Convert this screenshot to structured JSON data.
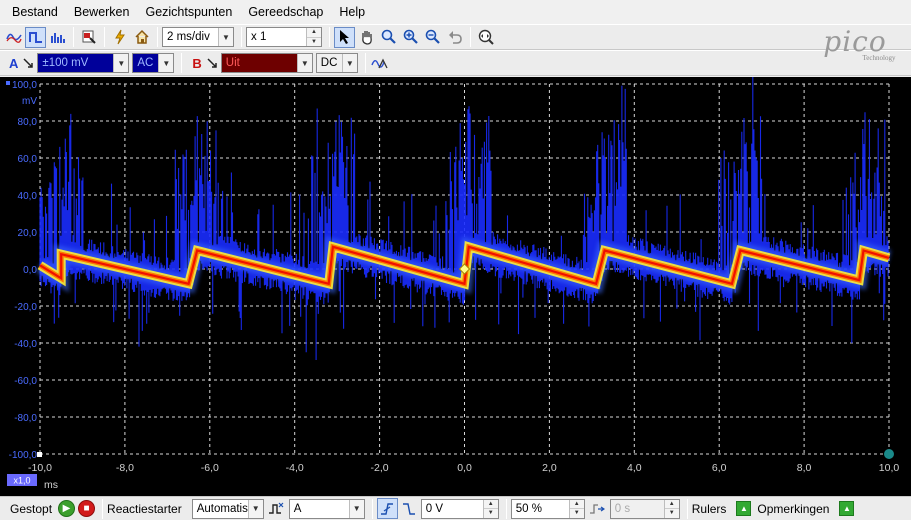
{
  "menu": [
    "Bestand",
    "Bewerken",
    "Gezichtspunten",
    "Gereedschap",
    "Help"
  ],
  "toolbar": {
    "timebase": "2 ms/div",
    "zoom_factor": "x 1",
    "icons": [
      "scope-mode-icon",
      "persistence-mode-icon",
      "spectrum-mode-icon",
      "record-icon",
      "signal-generator-icon",
      "home-icon",
      "select-tool-icon",
      "hand-tool-icon",
      "zoom-icon",
      "zoom-in-icon",
      "zoom-out-icon",
      "undo-zoom-icon",
      "zoom-fit-icon"
    ]
  },
  "channels": {
    "a": {
      "letter": "A",
      "range": "±100 mV",
      "coupling": "AC",
      "color": "#1d3ecf"
    },
    "b": {
      "letter": "B",
      "range": "Uit",
      "coupling": "DC",
      "color": "#c81010"
    }
  },
  "logo": {
    "word": "pico",
    "sub": "Technology"
  },
  "scope": {
    "y_unit": "mV",
    "y_ticks": [
      "100,0",
      "80,0",
      "60,0",
      "40,0",
      "20,0",
      "0,0",
      "-20,0",
      "-40,0",
      "-60,0",
      "-80,0",
      "-100,0"
    ],
    "x_ticks": [
      "-10,0",
      "-8,0",
      "-6,0",
      "-4,0",
      "-2,0",
      "0,0",
      "2,0",
      "4,0",
      "6,0",
      "8,0",
      "10,0"
    ],
    "x_unit": "ms",
    "zoom_badge": "x1,0"
  },
  "chart_data": {
    "type": "line",
    "title": "",
    "xlabel": "ms",
    "ylabel": "mV",
    "xlim": [
      -10,
      10
    ],
    "ylim": [
      -100,
      100
    ],
    "grid": true,
    "series": [
      {
        "x": [
          -10,
          -9.5,
          -9.5,
          -6.5,
          -6.3,
          -3.2,
          -3.1,
          0,
          0.1,
          3.1,
          3.3,
          6.3,
          6.5,
          9.3,
          9.4,
          10
        ],
        "y": [
          2,
          -5,
          8,
          -8,
          10,
          -8,
          12,
          -8,
          12,
          -8,
          10,
          -8,
          10,
          -6,
          10,
          6
        ]
      }
    ]
  },
  "statusbar": {
    "state": "Gestopt",
    "trigger_label": "Reactiestarter",
    "trigger_mode": "Automatis",
    "trigger_channel": "A",
    "threshold": "0 V",
    "pretrigger": "50 %",
    "delay": "0 s",
    "rulers": "Rulers",
    "notes": "Opmerkingen"
  }
}
